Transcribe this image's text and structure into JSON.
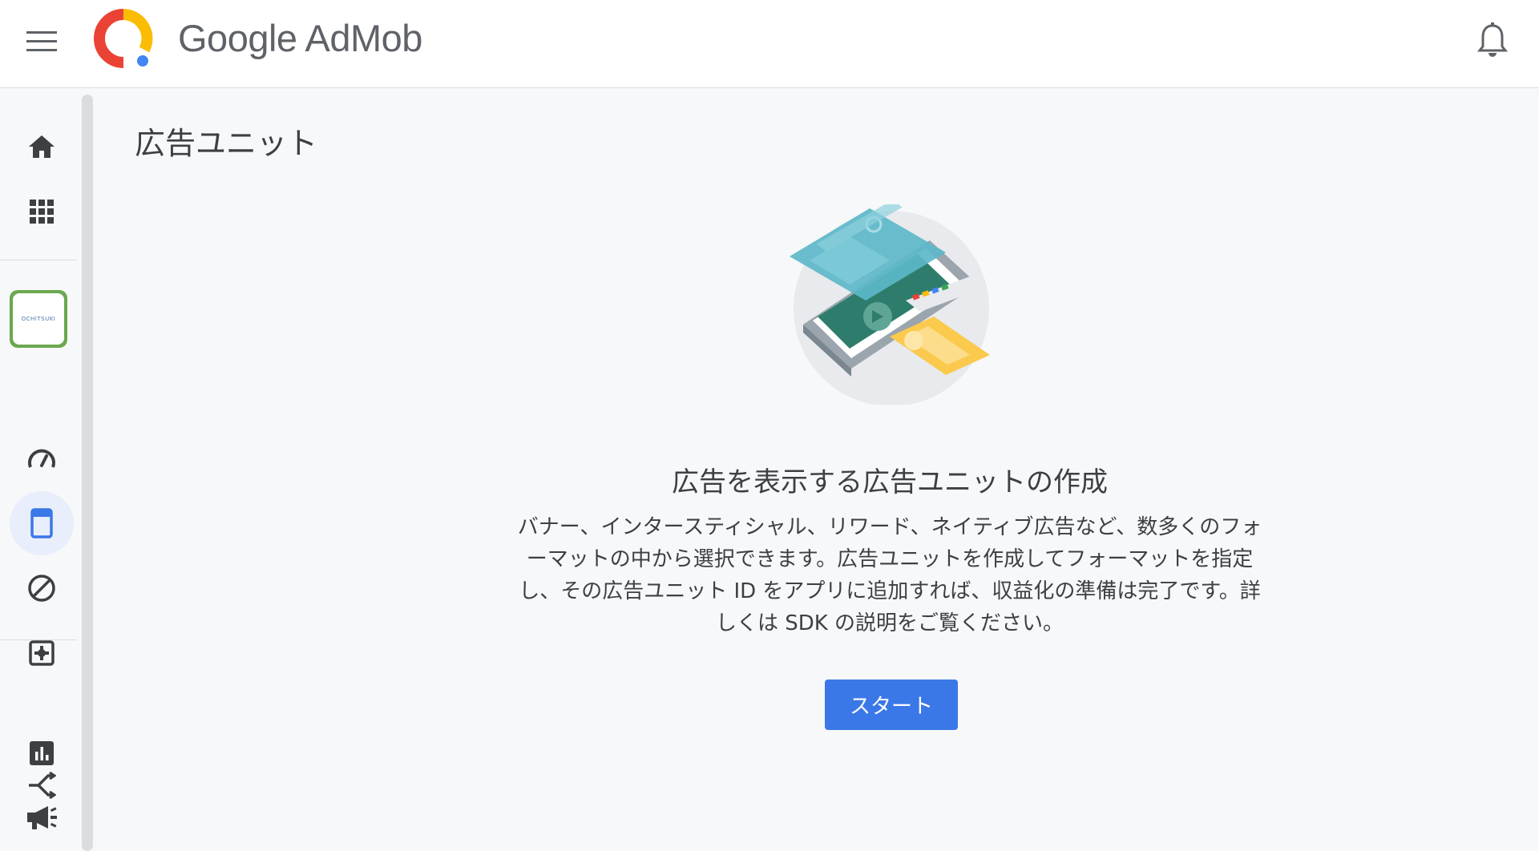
{
  "header": {
    "brand_google": "Google",
    "brand_product": "AdMob",
    "icons": [
      "menu-icon",
      "admob-logo",
      "notifications-bell-icon"
    ]
  },
  "sidebar": {
    "items": [
      {
        "name": "home",
        "icon": "home-icon"
      },
      {
        "name": "apps",
        "icon": "apps-grid-icon"
      },
      {
        "name": "app-ochitsuki",
        "icon": "app-thumbnail",
        "thumb_text": "OCHITSUKI"
      },
      {
        "name": "app-overview",
        "icon": "speedometer-icon"
      },
      {
        "name": "ad-units",
        "icon": "ad-unit-icon",
        "active": true
      },
      {
        "name": "blocking-controls",
        "icon": "block-icon"
      },
      {
        "name": "app-settings",
        "icon": "settings-box-icon"
      },
      {
        "name": "reports",
        "icon": "bar-chart-icon"
      },
      {
        "name": "mediation",
        "icon": "mediation-icon"
      },
      {
        "name": "campaigns",
        "icon": "megaphone-icon"
      }
    ]
  },
  "main": {
    "page_title": "広告ユニット",
    "empty_state": {
      "title": "広告を表示する広告ユニットの作成",
      "description": "バナー、インタースティシャル、リワード、ネイティブ広告など、数多くのフォーマットの中から選択できます。広告ユニットを作成してフォーマットを指定し、その広告ユニット ID をアプリに追加すれば、収益化の準備は完了です。詳しくは SDK の説明をご覧ください。",
      "start_label": "スタート"
    }
  },
  "colors": {
    "primary": "#3b78e7",
    "active_bg": "#e8eefb",
    "icon_dark": "#3c4043",
    "logo_red": "#ea4335",
    "logo_yellow": "#fbbc04",
    "logo_blue": "#4285f4"
  }
}
